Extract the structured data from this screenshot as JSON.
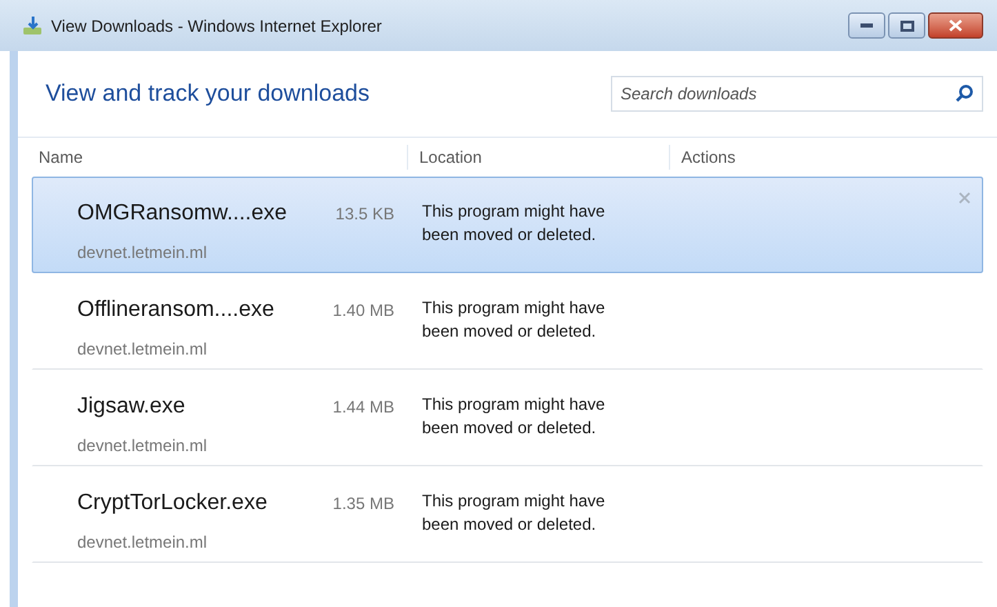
{
  "window": {
    "title": "View Downloads - Windows Internet Explorer"
  },
  "heading": "View and track your downloads",
  "search": {
    "placeholder": "Search downloads"
  },
  "table": {
    "columns": [
      "Name",
      "Location",
      "Actions"
    ],
    "rows": [
      {
        "name": "OMGRansomw....exe",
        "size": "13.5 KB",
        "source": "devnet.letmein.ml",
        "location": "This program might have been moved or deleted.",
        "selected": true
      },
      {
        "name": "Offlineransom....exe",
        "size": "1.40 MB",
        "source": "devnet.letmein.ml",
        "location": "This program might have been moved or deleted.",
        "selected": false
      },
      {
        "name": "Jigsaw.exe",
        "size": "1.44 MB",
        "source": "devnet.letmein.ml",
        "location": "This program might have been moved or deleted.",
        "selected": false
      },
      {
        "name": "CryptTorLocker.exe",
        "size": "1.35 MB",
        "source": "devnet.letmein.ml",
        "location": "This program might have been moved or deleted.",
        "selected": false
      }
    ]
  }
}
